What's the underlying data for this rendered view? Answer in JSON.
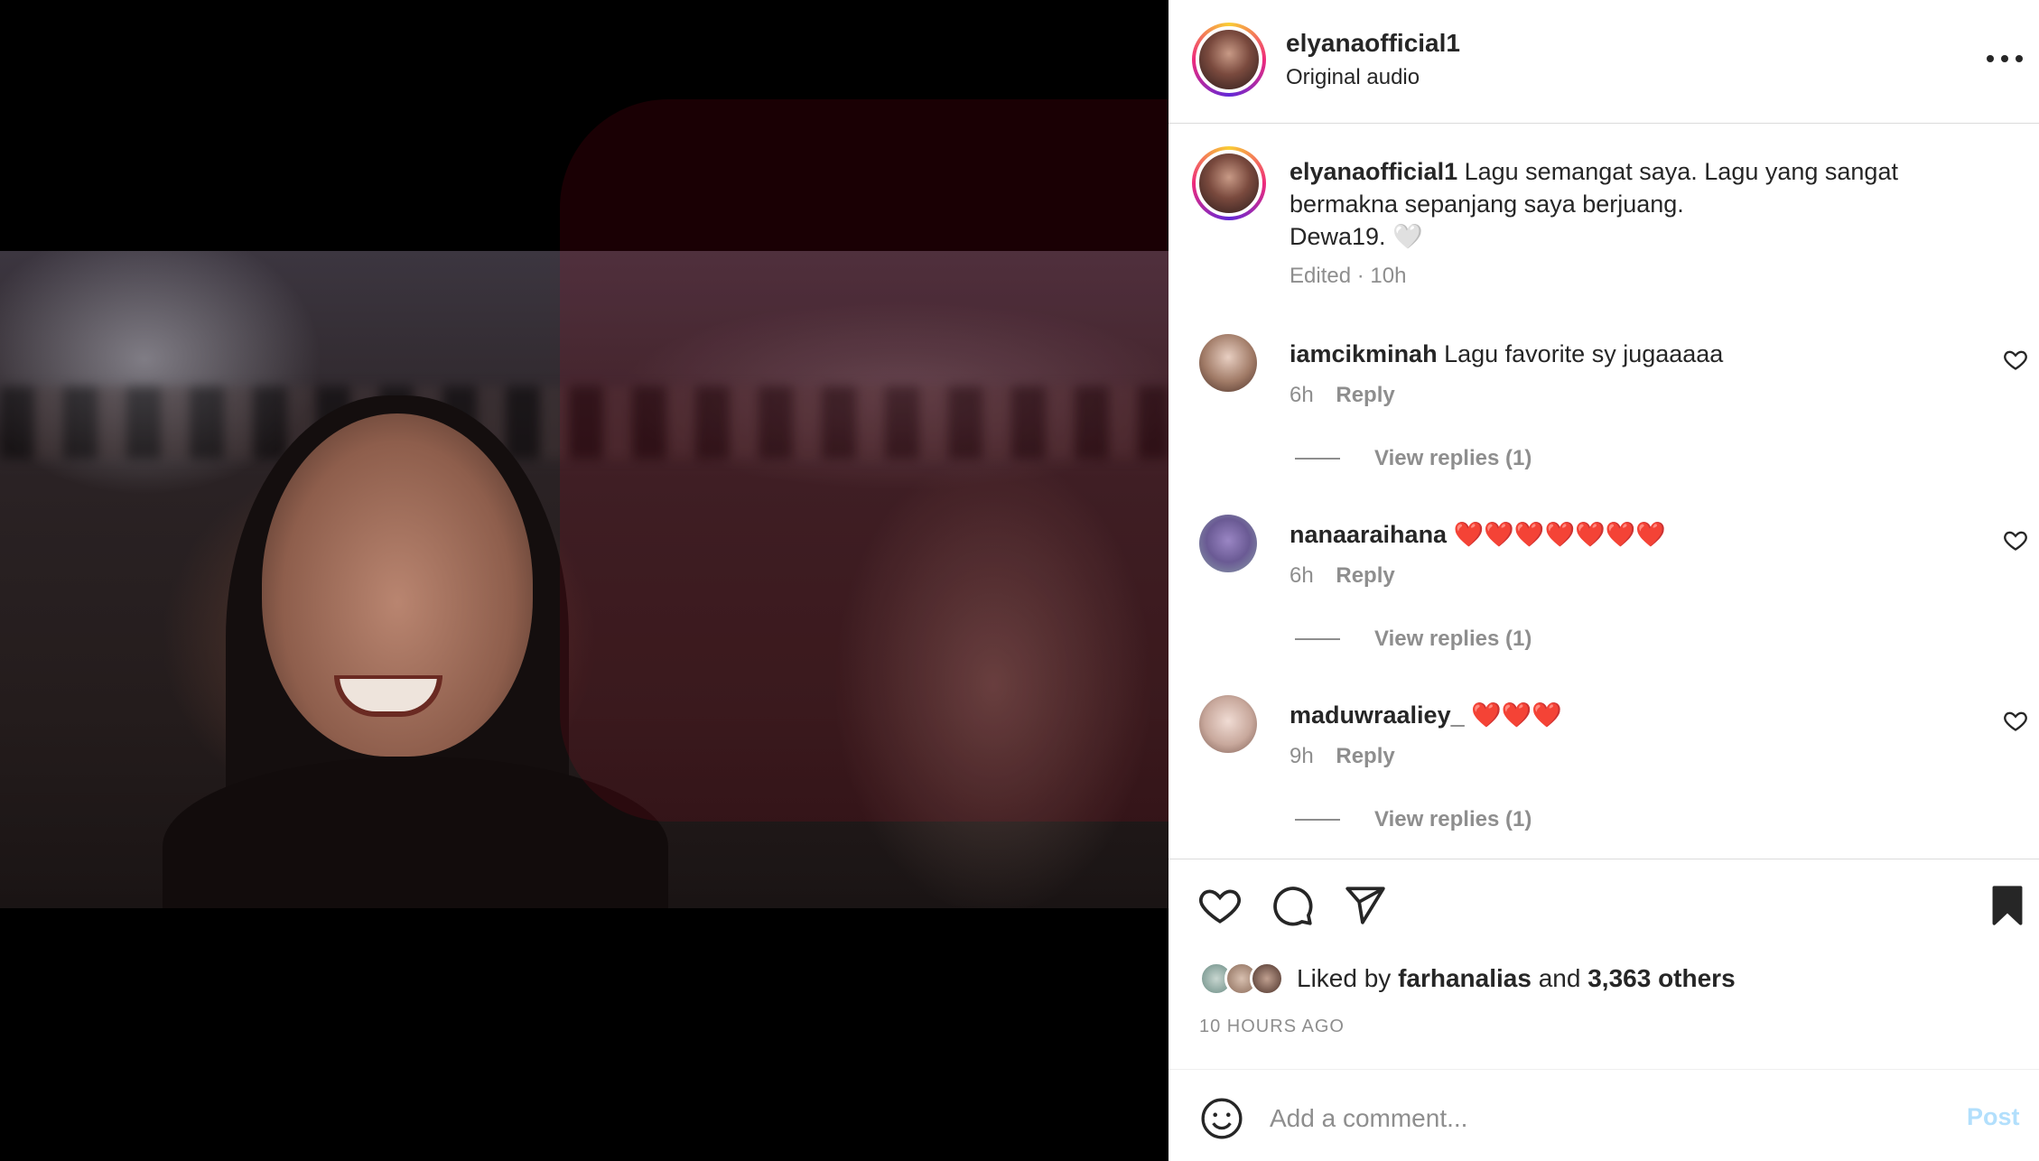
{
  "post": {
    "username": "elyanaofficial1",
    "audio": "Original audio"
  },
  "caption": {
    "username": "elyanaofficial1",
    "text": "Lagu semangat saya. Lagu yang sangat bermakna sepanjang saya berjuang.",
    "line3": "Dewa19.",
    "emoji": "🤍",
    "meta": "Edited · 10h"
  },
  "comments": [
    {
      "username": "iamcikminah",
      "text": "Lagu favorite sy jugaaaaa",
      "time": "6h",
      "reply": "Reply",
      "replies": "View replies (1)",
      "avatar_color": "#c9a896"
    },
    {
      "username": "nanaaraihana",
      "text": "❤️❤️❤️❤️❤️❤️❤️",
      "time": "6h",
      "reply": "Reply",
      "replies": "View replies (1)",
      "avatar_color": "#8a7ab0"
    },
    {
      "username": "maduwraaliey_",
      "text": "❤️❤️❤️",
      "time": "9h",
      "reply": "Reply",
      "replies": "View replies (1)",
      "avatar_color": "#d6b4a8"
    }
  ],
  "likes": {
    "prefix": "Liked by",
    "user": "farhanalias",
    "and": "and",
    "others": "3,363 others"
  },
  "time_ago": "10 HOURS AGO",
  "add_comment": {
    "placeholder": "Add a comment...",
    "post_label": "Post"
  },
  "colors": {
    "text": "#262626",
    "secondary": "#8e8e8e",
    "post_disabled": "#b2dffc",
    "heart_red": "#ed4956"
  },
  "icons": [
    "more-icon",
    "like-icon",
    "comment-icon",
    "share-icon",
    "save-icon",
    "emoji-icon",
    "mute-icon",
    "heart-small-icon"
  ]
}
